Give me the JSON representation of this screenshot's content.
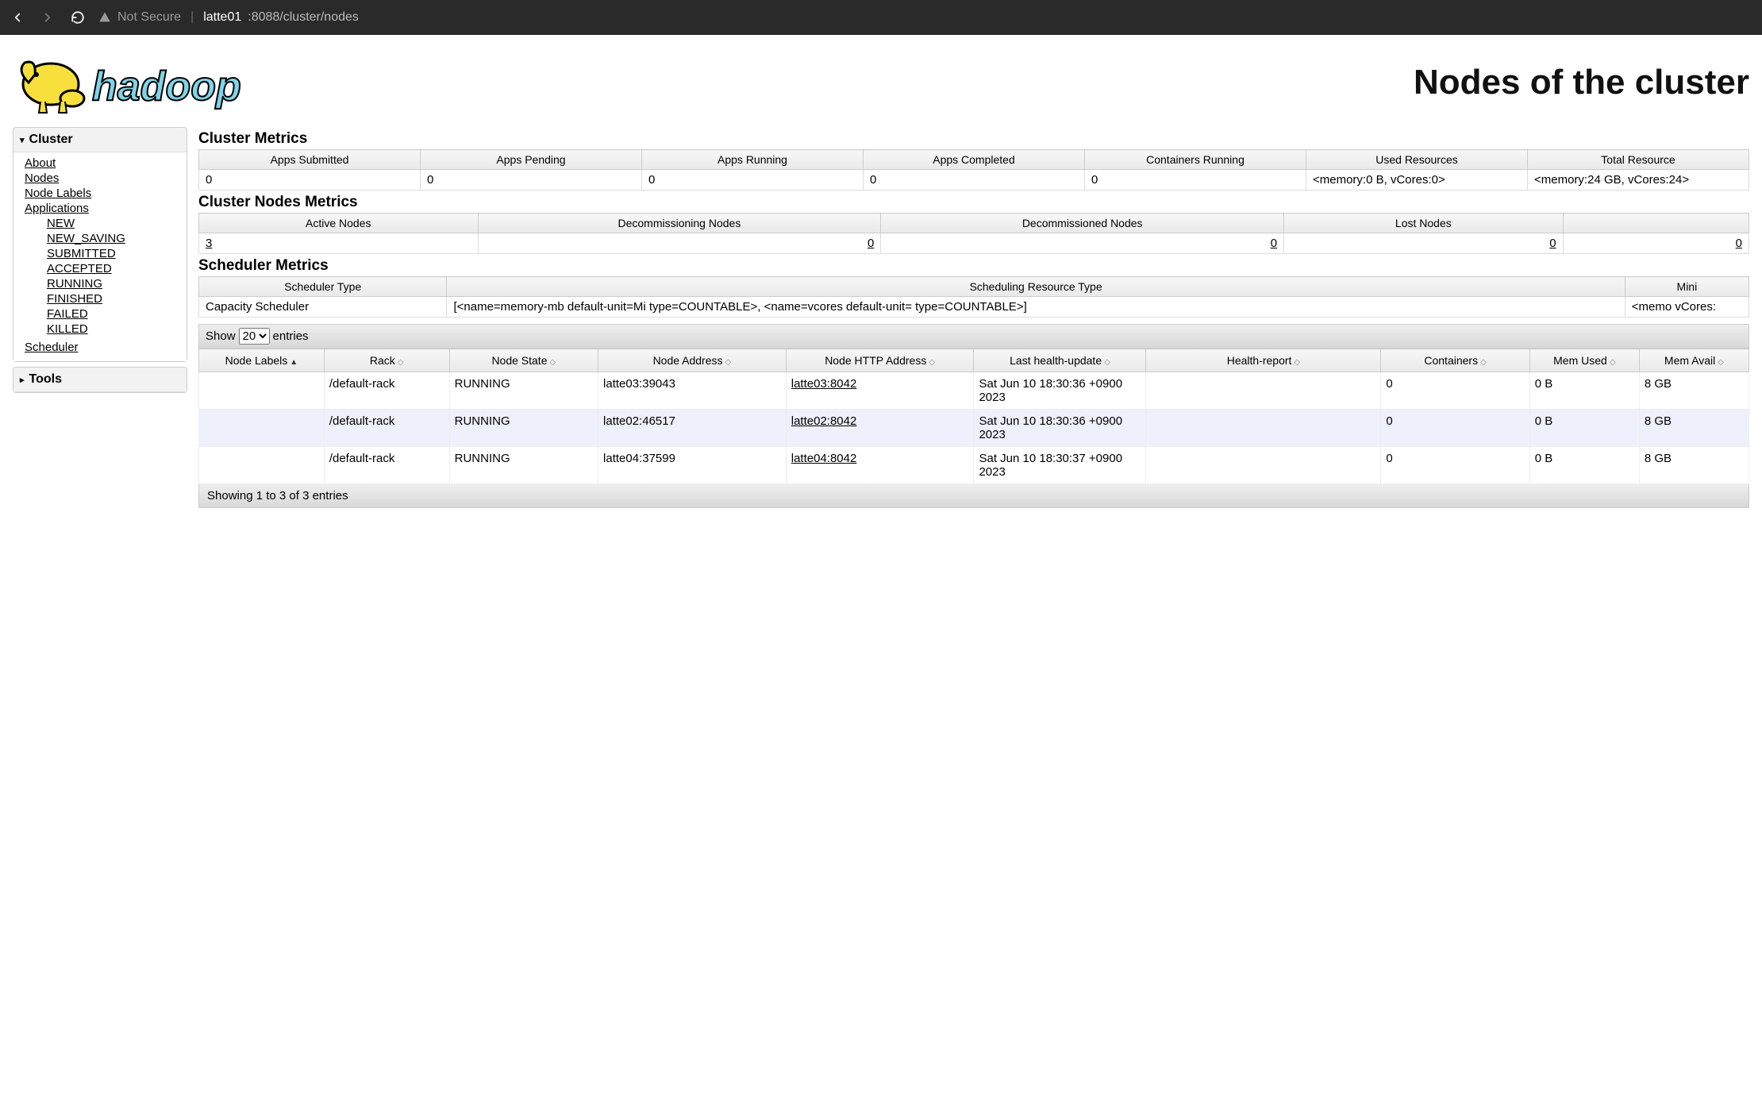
{
  "browser": {
    "not_secure_label": "Not Secure",
    "host": "latte01",
    "port_path": ":8088/cluster/nodes"
  },
  "page_title": "Nodes of the cluster",
  "sidebar": {
    "cluster_label": "Cluster",
    "links": {
      "about": "About",
      "nodes": "Nodes",
      "node_labels": "Node Labels",
      "applications": "Applications"
    },
    "app_states": [
      "NEW",
      "NEW_SAVING",
      "SUBMITTED",
      "ACCEPTED",
      "RUNNING",
      "FINISHED",
      "FAILED",
      "KILLED"
    ],
    "scheduler": "Scheduler",
    "tools_label": "Tools"
  },
  "sections": {
    "cluster_metrics": "Cluster Metrics",
    "cluster_nodes_metrics": "Cluster Nodes Metrics",
    "scheduler_metrics": "Scheduler Metrics"
  },
  "cluster_metrics": {
    "headers": [
      "Apps Submitted",
      "Apps Pending",
      "Apps Running",
      "Apps Completed",
      "Containers Running",
      "Used Resources",
      "Total Resource"
    ],
    "values": [
      "0",
      "0",
      "0",
      "0",
      "0",
      "<memory:0 B, vCores:0>",
      "<memory:24 GB, vCores:24>"
    ]
  },
  "cluster_nodes_metrics": {
    "headers": [
      "Active Nodes",
      "Decommissioning Nodes",
      "Decommissioned Nodes",
      "Lost Nodes",
      ""
    ],
    "values": [
      "3",
      "0",
      "0",
      "0",
      "0"
    ]
  },
  "scheduler_metrics": {
    "headers": [
      "Scheduler Type",
      "Scheduling Resource Type",
      "Mini"
    ],
    "values": [
      "Capacity Scheduler",
      "[<name=memory-mb default-unit=Mi type=COUNTABLE>, <name=vcores default-unit= type=COUNTABLE>]",
      "<memo vCores:"
    ]
  },
  "show_bar": {
    "show_label": "Show",
    "selected": "20",
    "entries_label": "entries"
  },
  "nodes_table": {
    "headers": [
      "Node Labels",
      "Rack",
      "Node State",
      "Node Address",
      "Node HTTP Address",
      "Last health-update",
      "Health-report",
      "Containers",
      "Mem Used",
      "Mem Avail"
    ],
    "rows": [
      {
        "labels": "",
        "rack": "/default-rack",
        "state": "RUNNING",
        "addr": "latte03:39043",
        "http": "latte03:8042",
        "health": "Sat Jun 10 18:30:36 +0900 2023",
        "report": "",
        "containers": "0",
        "mem_used": "0 B",
        "mem_avail": "8 GB"
      },
      {
        "labels": "",
        "rack": "/default-rack",
        "state": "RUNNING",
        "addr": "latte02:46517",
        "http": "latte02:8042",
        "health": "Sat Jun 10 18:30:36 +0900 2023",
        "report": "",
        "containers": "0",
        "mem_used": "0 B",
        "mem_avail": "8 GB"
      },
      {
        "labels": "",
        "rack": "/default-rack",
        "state": "RUNNING",
        "addr": "latte04:37599",
        "http": "latte04:8042",
        "health": "Sat Jun 10 18:30:37 +0900 2023",
        "report": "",
        "containers": "0",
        "mem_used": "0 B",
        "mem_avail": "8 GB"
      }
    ]
  },
  "footer": "Showing 1 to 3 of 3 entries"
}
